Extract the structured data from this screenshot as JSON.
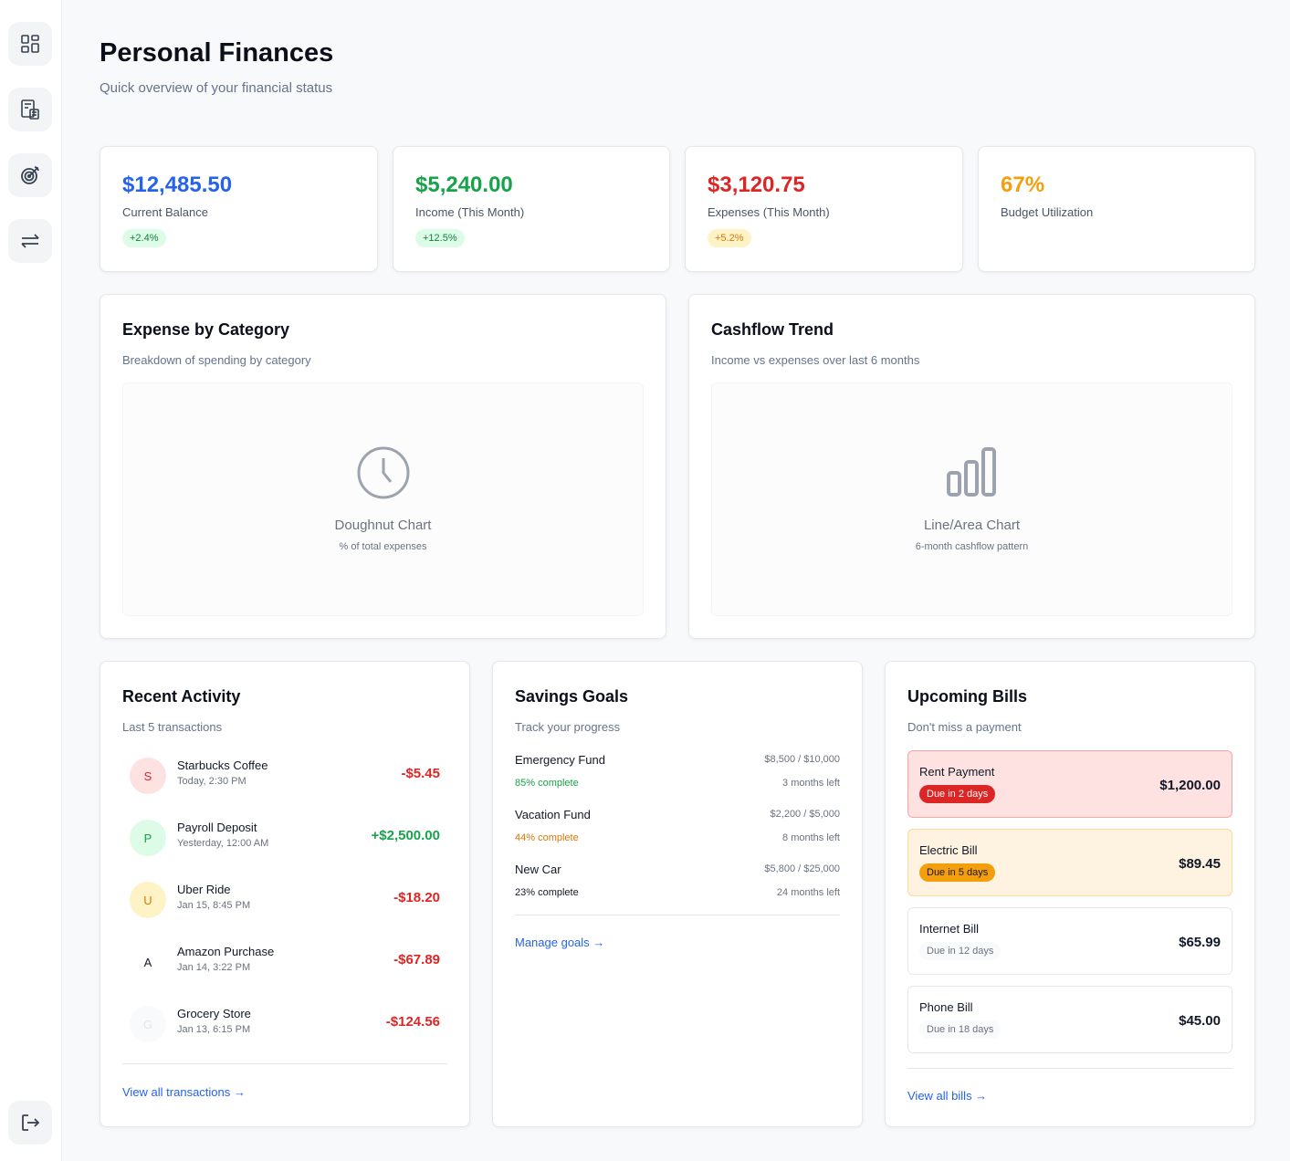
{
  "page": {
    "title": "Personal Finances",
    "subtitle": "Quick overview of your financial status"
  },
  "sidebar": {
    "items": [
      {
        "icon": "dashboard-icon"
      },
      {
        "icon": "calculator-icon"
      },
      {
        "icon": "target-icon"
      },
      {
        "icon": "transfer-icon"
      }
    ],
    "logout_icon": "logout-icon"
  },
  "stats": [
    {
      "value": "$12,485.50",
      "label": "Current Balance",
      "badge": "+2.4%",
      "color": "#2563eb",
      "badge_bg": "#dcfce7",
      "badge_fg": "#15803d"
    },
    {
      "value": "$5,240.00",
      "label": "Income (This Month)",
      "badge": "+12.5%",
      "color": "#16a34a",
      "badge_bg": "#dcfce7",
      "badge_fg": "#15803d"
    },
    {
      "value": "$3,120.75",
      "label": "Expenses (This Month)",
      "badge": "+5.2%",
      "color": "#dc2626",
      "badge_bg": "#fef3c7",
      "badge_fg": "#d97706"
    },
    {
      "value": "67%",
      "label": "Budget Utilization",
      "badge": "",
      "color": "#f59e0b"
    }
  ],
  "expense_chart": {
    "title": "Expense by Category",
    "subtitle": "Breakdown of spending by category",
    "placeholder_name": "Doughnut Chart",
    "placeholder_desc": "% of total expenses",
    "icon": "clock-icon"
  },
  "cashflow_chart": {
    "title": "Cashflow Trend",
    "subtitle": "Income vs expenses over last 6 months",
    "placeholder_name": "Line/Area Chart",
    "placeholder_desc": "6-month cashflow pattern",
    "icon": "bar-chart-icon"
  },
  "activity": {
    "title": "Recent Activity",
    "subtitle": "Last 5 transactions",
    "link": "View all transactions →",
    "items": [
      {
        "initial": "S",
        "name": "Starbucks Coffee",
        "time": "Today, 2:30 PM",
        "amount": "-$5.45",
        "color": "#dc2626",
        "avatar_bg": "#fee2e2",
        "avatar_fg": "#dc2626"
      },
      {
        "initial": "P",
        "name": "Payroll Deposit",
        "time": "Yesterday, 12:00 AM",
        "amount": "+$2,500.00",
        "color": "#16a34a",
        "avatar_bg": "#dcfce7",
        "avatar_fg": "#16a34a"
      },
      {
        "initial": "U",
        "name": "Uber Ride",
        "time": "Jan 15, 8:45 PM",
        "amount": "-$18.20",
        "color": "#dc2626",
        "avatar_bg": "#fef3c7",
        "avatar_fg": "#d97706"
      },
      {
        "initial": "A",
        "name": "Amazon Purchase",
        "time": "Jan 14, 3:22 PM",
        "amount": "-$67.89",
        "color": "#dc2626",
        "avatar_bg": "#ffffff",
        "avatar_fg": "#111827"
      },
      {
        "initial": "G",
        "name": "Grocery Store",
        "time": "Jan 13, 6:15 PM",
        "amount": "-$124.56",
        "color": "#dc2626",
        "avatar_bg": "#f9fafb",
        "avatar_fg": "#e5e7eb"
      }
    ]
  },
  "savings": {
    "title": "Savings Goals",
    "subtitle": "Track your progress",
    "link": "Manage goals →",
    "goals": [
      {
        "name": "Emergency Fund",
        "amount": "$8,500 / $10,000",
        "percent_text": "85% complete",
        "remaining": "3 months left",
        "color": "#16a34a"
      },
      {
        "name": "Vacation Fund",
        "amount": "$2,200 / $5,000",
        "percent_text": "44% complete",
        "remaining": "8 months left",
        "color": "#d97706"
      },
      {
        "name": "New Car",
        "amount": "$5,800 / $25,000",
        "percent_text": "23% complete",
        "remaining": "24 months left",
        "color": "#111827"
      }
    ]
  },
  "bills": {
    "title": "Upcoming Bills",
    "subtitle": "Don't miss a payment",
    "link": "View all bills →",
    "items": [
      {
        "name": "Rent Payment",
        "due": "Due in 2 days",
        "amount": "$1,200.00",
        "bg": "#fee2e2",
        "border": "#fca5a5",
        "due_bg": "#dc2626",
        "due_fg": "#ffffff"
      },
      {
        "name": "Electric Bill",
        "due": "Due in 5 days",
        "amount": "$89.45",
        "bg": "#fef3e0",
        "border": "#fcd9a0",
        "due_bg": "#f59e0b",
        "due_fg": "#111827"
      },
      {
        "name": "Internet Bill",
        "due": "Due in 12 days",
        "amount": "$65.99",
        "bg": "#ffffff",
        "border": "#e5e7eb",
        "due_bg": "#f9fafb",
        "due_fg": "#6b7280"
      },
      {
        "name": "Phone Bill",
        "due": "Due in 18 days",
        "amount": "$45.00",
        "bg": "#ffffff",
        "border": "#e5e7eb",
        "due_bg": "#f9fafb",
        "due_fg": "#6b7280"
      }
    ]
  }
}
